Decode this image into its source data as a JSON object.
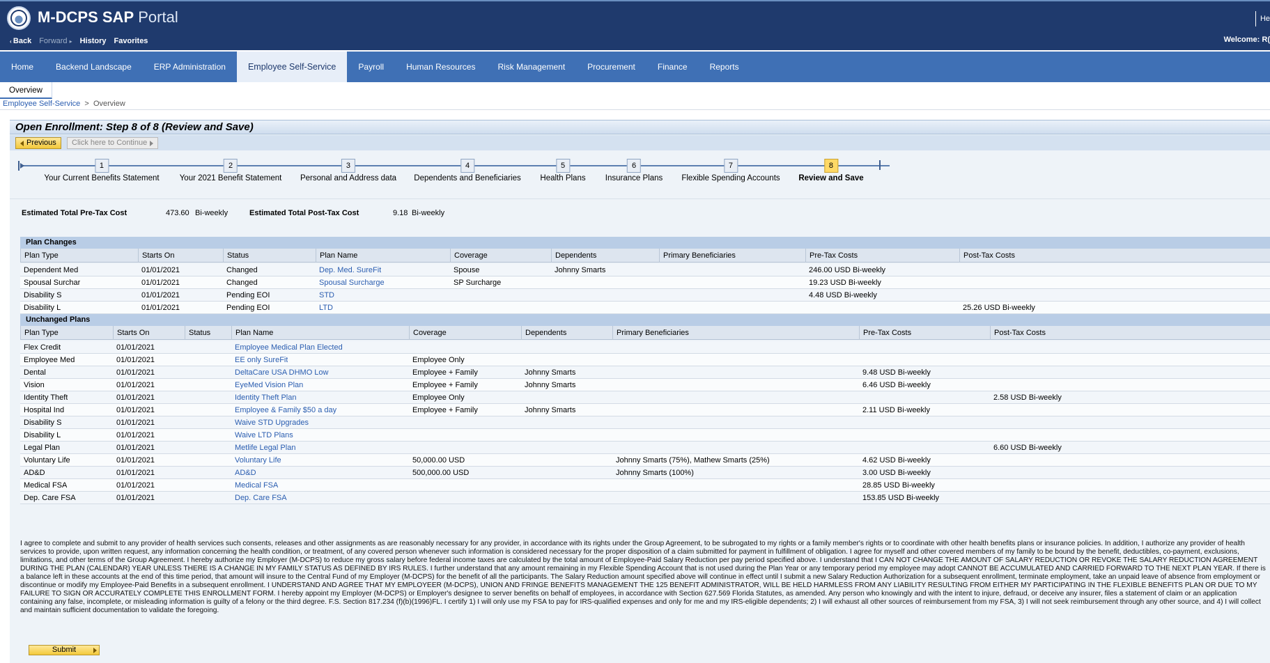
{
  "header": {
    "brand_bold": "M-DCPS SAP",
    "brand_light": "Portal",
    "nav": {
      "back": "Back",
      "forward": "Forward",
      "history": "History",
      "favorites": "Favorites"
    },
    "help": "He",
    "welcome": "Welcome: R("
  },
  "top_nav": [
    "Home",
    "Backend Landscape",
    "ERP Administration",
    "Employee Self-Service",
    "Payroll",
    "Human Resources",
    "Risk Management",
    "Procurement",
    "Finance",
    "Reports"
  ],
  "sub_nav": {
    "overview": "Overview"
  },
  "breadcrumb": {
    "root": "Employee Self-Service",
    "sep": ">",
    "current": "Overview"
  },
  "page": {
    "title": "Open Enrollment: Step 8  of 8  (Review and Save)",
    "previous": "Previous",
    "continue": "Click here to Continue"
  },
  "steps": [
    {
      "n": "1",
      "label": "Your Current Benefits Statement"
    },
    {
      "n": "2",
      "label": "Your 2021 Benefit Statement"
    },
    {
      "n": "3",
      "label": "Personal and Address data"
    },
    {
      "n": "4",
      "label": "Dependents and Beneficiaries"
    },
    {
      "n": "5",
      "label": "Health Plans"
    },
    {
      "n": "6",
      "label": "Insurance Plans"
    },
    {
      "n": "7",
      "label": "Flexible Spending Accounts"
    },
    {
      "n": "8",
      "label": "Review and Save"
    }
  ],
  "totals": {
    "pre_label": "Estimated Total Pre-Tax Cost",
    "pre_value": "473.60",
    "pre_period": "Bi-weekly",
    "post_label": "Estimated Total Post-Tax Cost",
    "post_value": "9.18",
    "post_period": "Bi-weekly"
  },
  "plan_changes": {
    "title": "Plan Changes",
    "columns": [
      "Plan Type",
      "Starts On",
      "Status",
      "Plan Name",
      "Coverage",
      "Dependents",
      "Primary Beneficiaries",
      "Pre-Tax Costs",
      "Post-Tax Costs"
    ],
    "rows": [
      [
        "Dependent Med",
        "01/01/2021",
        "Changed",
        "Dep. Med. SureFit",
        "Spouse",
        "Johnny Smarts",
        "",
        "246.00 USD Bi-weekly",
        ""
      ],
      [
        "Spousal Surchar",
        "01/01/2021",
        "Changed",
        "Spousal Surcharge",
        "SP Surcharge",
        "",
        "",
        "19.23 USD Bi-weekly",
        ""
      ],
      [
        "Disability S",
        "01/01/2021",
        "Pending EOI",
        "STD",
        "",
        "",
        "",
        "4.48 USD Bi-weekly",
        ""
      ],
      [
        "Disability L",
        "01/01/2021",
        "Pending EOI",
        "LTD",
        "",
        "",
        "",
        "",
        "25.26 USD Bi-weekly"
      ]
    ]
  },
  "unchanged_plans": {
    "title": "Unchanged Plans",
    "columns": [
      "Plan Type",
      "Starts On",
      "Status",
      "Plan Name",
      "Coverage",
      "Dependents",
      "Primary Beneficiaries",
      "Pre-Tax Costs",
      "Post-Tax Costs"
    ],
    "rows": [
      [
        "Flex Credit",
        "01/01/2021",
        "",
        "Employee Medical Plan Elected",
        "",
        "",
        "",
        "",
        ""
      ],
      [
        "Employee Med",
        "01/01/2021",
        "",
        "EE only SureFit",
        "Employee Only",
        "",
        "",
        "",
        ""
      ],
      [
        "Dental",
        "01/01/2021",
        "",
        "DeltaCare USA DHMO Low",
        "Employee + Family",
        "Johnny Smarts",
        "",
        "9.48 USD Bi-weekly",
        ""
      ],
      [
        "Vision",
        "01/01/2021",
        "",
        "EyeMed Vision Plan",
        "Employee + Family",
        "Johnny Smarts",
        "",
        "6.46 USD Bi-weekly",
        ""
      ],
      [
        "Identity Theft",
        "01/01/2021",
        "",
        "Identity Theft Plan",
        "Employee Only",
        "",
        "",
        "",
        "2.58 USD Bi-weekly"
      ],
      [
        "Hospital Ind",
        "01/01/2021",
        "",
        "Employee & Family $50 a day",
        "Employee + Family",
        "Johnny Smarts",
        "",
        "2.11 USD Bi-weekly",
        ""
      ],
      [
        "Disability S",
        "01/01/2021",
        "",
        "Waive STD Upgrades",
        "",
        "",
        "",
        "",
        ""
      ],
      [
        "Disability L",
        "01/01/2021",
        "",
        "Waive LTD Plans",
        "",
        "",
        "",
        "",
        ""
      ],
      [
        "Legal Plan",
        "01/01/2021",
        "",
        "Metlife Legal Plan",
        "",
        "",
        "",
        "",
        "6.60 USD Bi-weekly"
      ],
      [
        "Voluntary Life",
        "01/01/2021",
        "",
        "Voluntary Life",
        "50,000.00 USD",
        "",
        "Johnny Smarts (75%), Mathew Smarts (25%)",
        "4.62 USD Bi-weekly",
        ""
      ],
      [
        "AD&D",
        "01/01/2021",
        "",
        "AD&D",
        "500,000.00 USD",
        "",
        "Johnny Smarts (100%)",
        "3.00 USD Bi-weekly",
        ""
      ],
      [
        "Medical FSA",
        "01/01/2021",
        "",
        "Medical FSA",
        "",
        "",
        "",
        "28.85 USD Bi-weekly",
        ""
      ],
      [
        "Dep. Care FSA",
        "01/01/2021",
        "",
        "Dep. Care FSA",
        "",
        "",
        "",
        "153.85 USD Bi-weekly",
        ""
      ]
    ]
  },
  "legal_text": "I agree to complete and submit to any provider of health services such consents, releases and other assignments as are reasonably necessary for any provider, in accordance with its rights under the Group Agreement, to be subrogated to my rights or a family member's rights or to coordinate with other health benefits plans or insurance policies. In addition, I authorize any provider of health services to provide, upon written request, any information concerning the health condition, or treatment, of any covered person whenever such information is considered necessary for the proper disposition of a claim submitted for payment in fulfillment of obligation. I agree for myself and other covered members of my family to be bound by the benefit, deductibles, co-payment, exclusions, limitations, and other terms of the Group Agreement. I hereby authorize my Employer (M-DCPS) to reduce my gross salary before federal income taxes are calculated by the total amount of Employee-Paid Salary Reduction per pay period specified above. I understand that I CAN NOT CHANGE THE AMOUNT OF SALARY REDUCTION OR REVOKE THE SALARY REDUCTION AGREEMENT DURING THE PLAN (CALENDAR) YEAR UNLESS THERE IS A CHANGE IN MY FAMILY STATUS AS DEFINED BY IRS RULES. I further understand that any amount remaining in my Flexible Spending Account that is not used during the Plan Year or any temporary period my employee may adopt CANNOT BE ACCUMULATED AND CARRIED FORWARD TO THE NEXT PLAN YEAR. If there is a balance left in these accounts at the end of this time period, that amount will insure to the Central Fund of my Employer (M-DCPS) for the benefit of all the participants. The Salary Reduction amount specified above will continue in effect until I submit a new Salary Reduction Authorization for a subsequent enrollment, terminate employment, take an unpaid leave of absence from employment or discontinue or modify my Employee-Paid Benefits in a subsequent enrollment. I UNDERSTAND AND AGREE THAT MY EMPLOYEER (M-DCPS), UNION AND FRINGE BENEFITS MANAGEMENT THE 125 BENEFIT ADMINISTRATOR, WILL BE HELD HARMLESS FROM ANY LIABILITY RESULTING FROM EITHER MY PARTICIPATING IN THE FLEXIBLE BENEFITS PLAN OR DUE TO MY FAILURE TO SIGN OR ACCURATELY COMPLETE THIS ENROLLMENT FORM. I hereby appoint my Employer (M-DCPS) or Employer's designee to server benefits on behalf of employees, in accordance with Section 627.569 Florida Statutes, as amended. Any person who knowingly and with the intent to injure, defraud, or deceive any insurer, files a statement of claim or an application containing any false, incomplete, or misleading information is guilty of a felony or the third degree. F.S. Section 817.234 (f)(b)(1996)FL. I certify 1) I will only use my FSA to pay for IRS-qualified expenses and only for me and my IRS-eligible dependents; 2) I will exhaust all other sources of reimbursement from my FSA, 3) I will not seek reimbursement through any other source, and 4) I will collect and maintain sufficient documentation to validate the foregoing.",
  "submit": "Submit"
}
